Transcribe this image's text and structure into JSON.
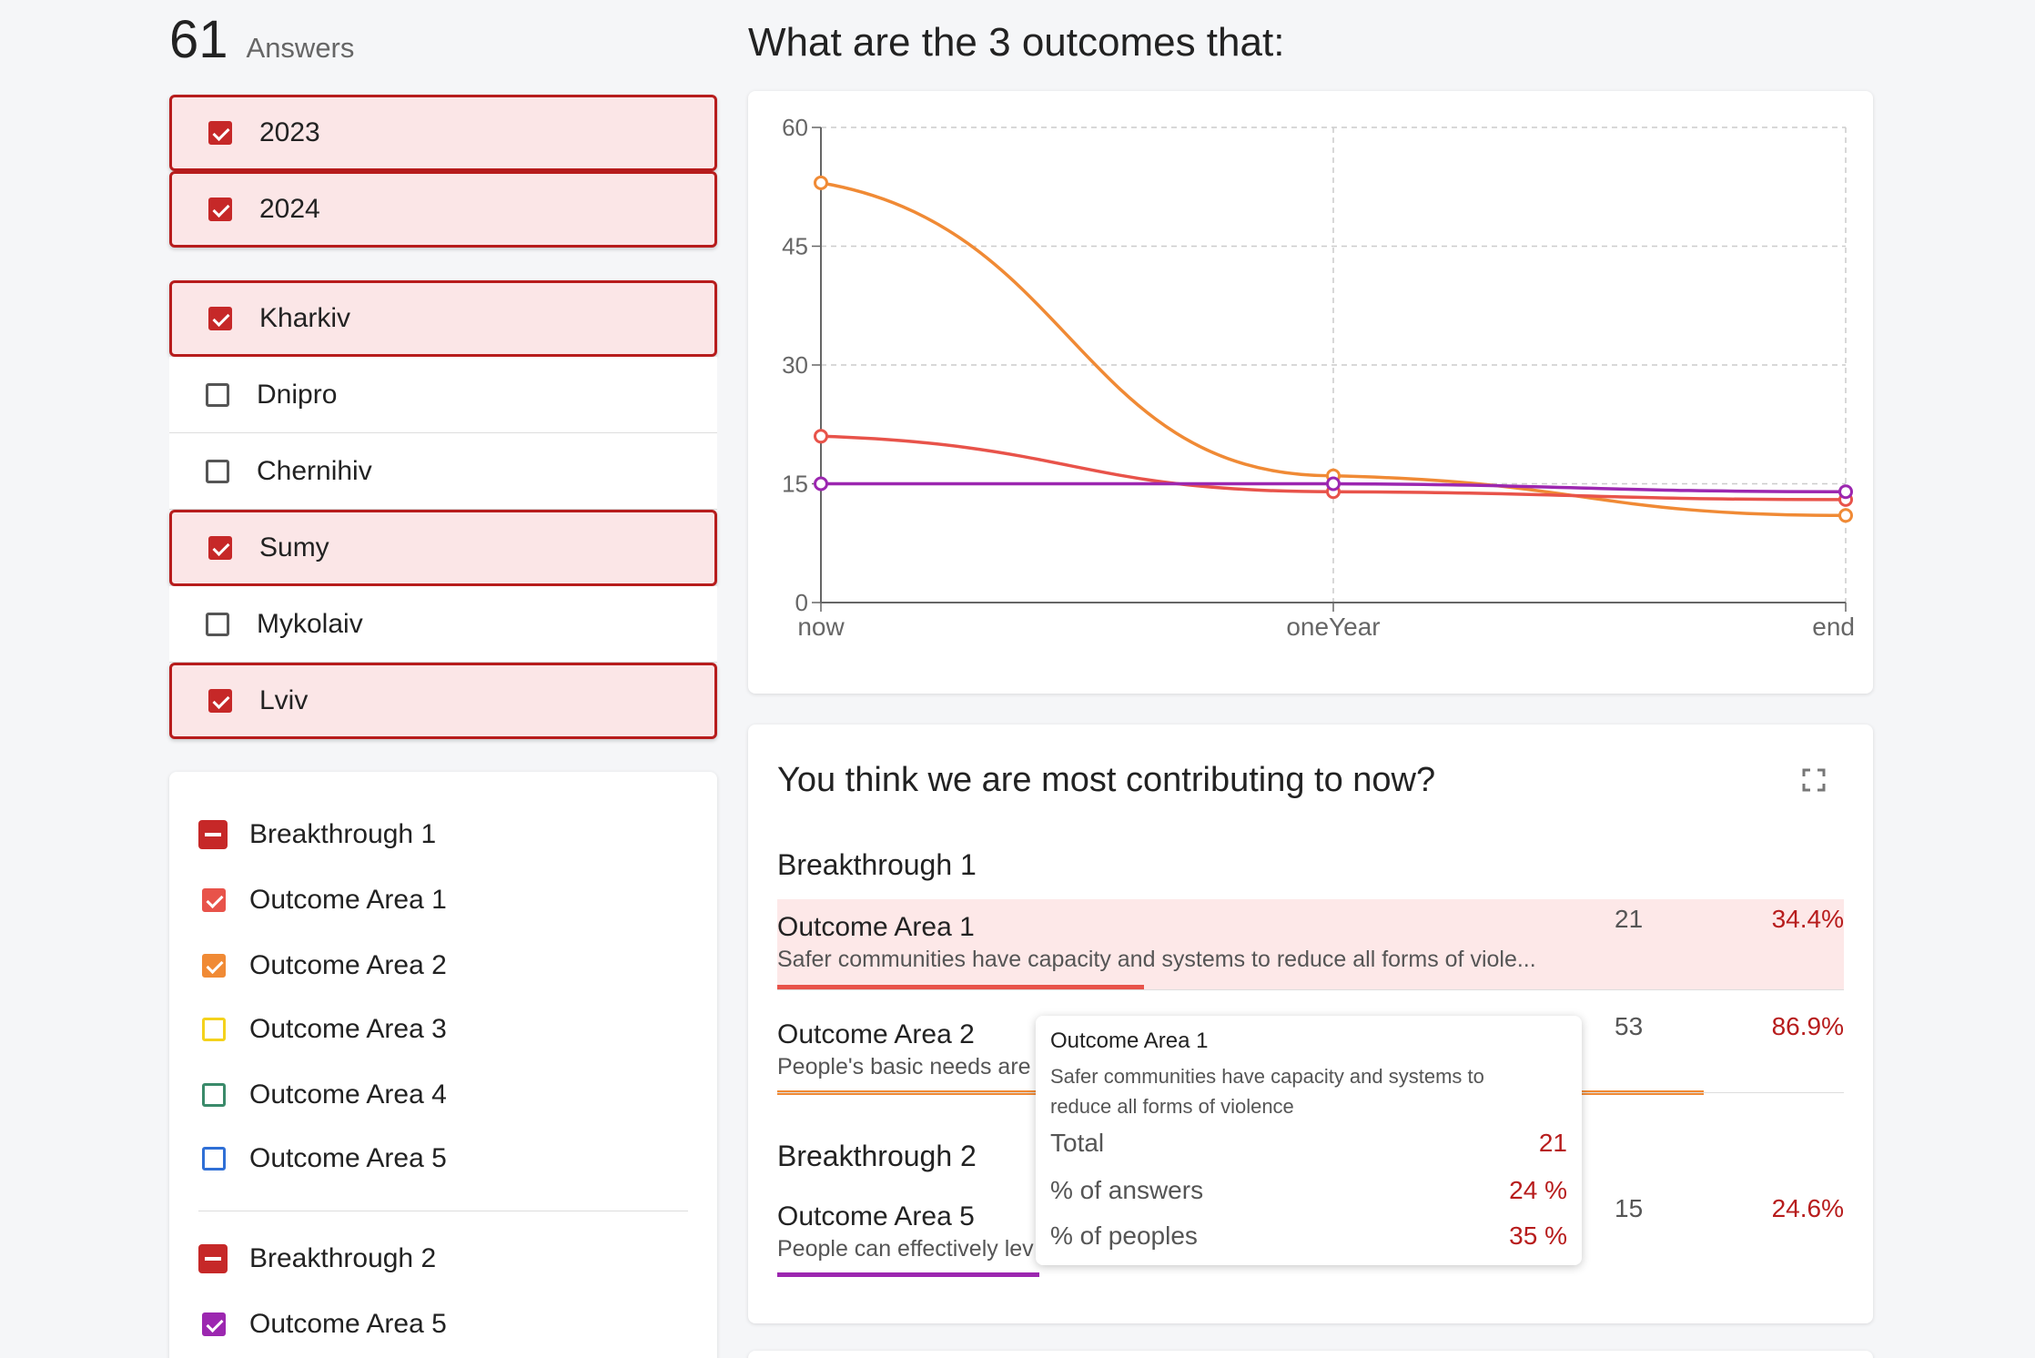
{
  "header": {
    "answers_count": "61",
    "answers_label": "Answers"
  },
  "years": [
    {
      "label": "2023",
      "checked": true
    },
    {
      "label": "2024",
      "checked": true
    }
  ],
  "cities": [
    {
      "label": "Kharkiv",
      "checked": true
    },
    {
      "label": "Dnipro",
      "checked": false
    },
    {
      "label": "Chernihiv",
      "checked": false
    },
    {
      "label": "Sumy",
      "checked": true
    },
    {
      "label": "Mykolaiv",
      "checked": false
    },
    {
      "label": "Lviv",
      "checked": true
    }
  ],
  "filters": {
    "breakthrough1": "Breakthrough 1",
    "areas1": [
      {
        "label": "Outcome Area 1",
        "color": "#e8534a",
        "checked": true
      },
      {
        "label": "Outcome Area 2",
        "color": "#f08a35",
        "checked": true
      },
      {
        "label": "Outcome Area 3",
        "color": "#f4d21c",
        "checked": false
      },
      {
        "label": "Outcome Area 4",
        "color": "#3a8a6a",
        "checked": false
      },
      {
        "label": "Outcome Area 5",
        "color": "#2f6fd6",
        "checked": false
      }
    ],
    "breakthrough2": "Breakthrough 2",
    "areas2": [
      {
        "label": "Outcome Area 5",
        "color": "#9c27b0",
        "checked": true
      }
    ]
  },
  "question": {
    "title": "What are the 3 outcomes that:"
  },
  "chart_data": {
    "type": "line",
    "x": [
      "now",
      "oneYear",
      "end"
    ],
    "ylim": [
      0,
      60
    ],
    "yticks": [
      0,
      15,
      30,
      45,
      60
    ],
    "grid": true,
    "series": [
      {
        "color": "#f08a35",
        "values": [
          53,
          16,
          11
        ]
      },
      {
        "color": "#e8534a",
        "values": [
          21,
          14,
          13
        ]
      },
      {
        "color": "#9c27b0",
        "values": [
          15,
          15,
          14
        ]
      }
    ]
  },
  "contrib": {
    "title": "You think we are most contributing to now?",
    "breakthrough1": "Breakthrough 1",
    "breakthrough2": "Breakthrough 2",
    "rows": [
      {
        "name": "Outcome Area 1",
        "desc": "Safer communities have capacity and systems to reduce all forms of viole...",
        "count": "21",
        "pct": "34.4%",
        "fraction": 0.344,
        "color": "#e8534a"
      },
      {
        "name": "Outcome Area 2",
        "desc": "People's basic needs are",
        "count": "53",
        "pct": "86.9%",
        "fraction": 0.869,
        "color": "#f08a35"
      },
      {
        "name": "Outcome Area 5",
        "desc": "People can effectively lev",
        "count": "15",
        "pct": "24.6%",
        "fraction": 0.246,
        "color": "#9c27b0"
      }
    ]
  },
  "tooltip": {
    "title": "Outcome Area 1",
    "desc": "Safer communities have capacity and systems to reduce all forms of violence",
    "total_label": "Total",
    "total_value": "21",
    "answers_label": "% of answers",
    "answers_value": "24 %",
    "peoples_label": "% of peoples",
    "peoples_value": "35 %"
  }
}
